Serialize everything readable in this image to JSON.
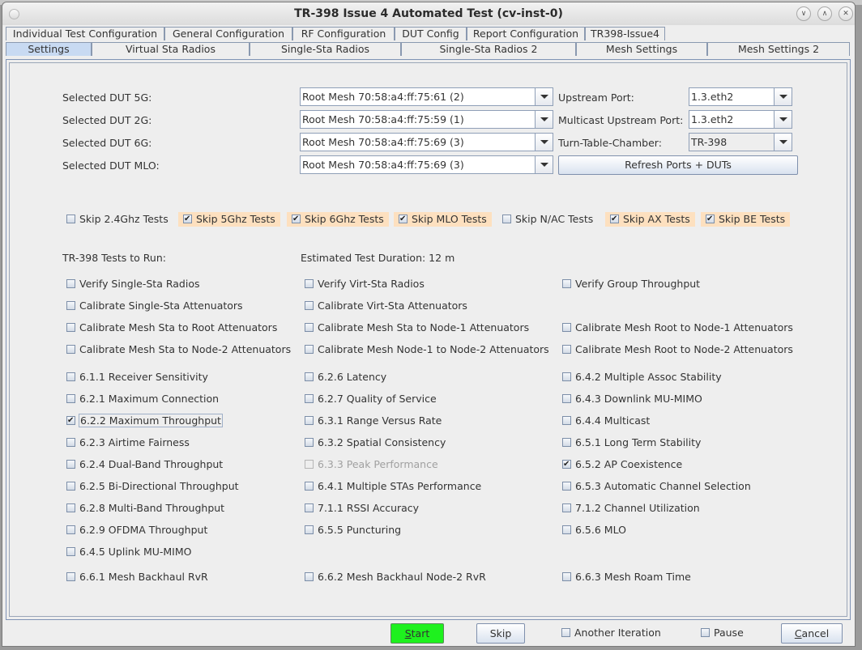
{
  "window": {
    "title": "TR-398 Issue 4 Automated Test  (cv-inst-0)",
    "controls": [
      "minimize",
      "maximize",
      "close"
    ]
  },
  "tabs_row1": [
    {
      "label": "Individual Test Configuration"
    },
    {
      "label": "General Configuration"
    },
    {
      "label": "RF Configuration"
    },
    {
      "label": "DUT Config"
    },
    {
      "label": "Report Configuration"
    },
    {
      "label": "TR398-Issue4"
    }
  ],
  "tabs_row2": [
    {
      "label": "Settings",
      "selected": true
    },
    {
      "label": "Virtual Sta Radios"
    },
    {
      "label": "Single-Sta Radios"
    },
    {
      "label": "Single-Sta Radios 2"
    },
    {
      "label": "Mesh Settings"
    },
    {
      "label": "Mesh Settings 2"
    }
  ],
  "settings": {
    "dut_fields": [
      {
        "label": "Selected DUT 5G:",
        "value": "Root Mesh 70:58:a4:ff:75:61 (2)"
      },
      {
        "label": "Selected DUT 2G:",
        "value": "Root Mesh 70:58:a4:ff:75:59 (1)"
      },
      {
        "label": "Selected DUT 6G:",
        "value": "Root Mesh 70:58:a4:ff:75:69 (3)"
      },
      {
        "label": "Selected DUT MLO:",
        "value": "Root Mesh 70:58:a4:ff:75:69 (3)"
      }
    ],
    "port_fields": [
      {
        "label": "Upstream Port:",
        "value": "1.3.eth2"
      },
      {
        "label": "Multicast Upstream Port:",
        "value": "1.3.eth2"
      },
      {
        "label": "Turn-Table-Chamber:",
        "value": "TR-398"
      }
    ],
    "refresh_button": "Refresh Ports + DUTs",
    "skip_options": [
      {
        "label": "Skip 2.4Ghz Tests",
        "checked": false
      },
      {
        "label": "Skip 5Ghz Tests",
        "checked": true
      },
      {
        "label": "Skip 6Ghz Tests",
        "checked": true
      },
      {
        "label": "Skip MLO Tests",
        "checked": true
      },
      {
        "label": "Skip N/AC Tests",
        "checked": false
      },
      {
        "label": "Skip AX Tests",
        "checked": true
      },
      {
        "label": "Skip BE Tests",
        "checked": true
      }
    ],
    "skip_highlight_color": "#fde0bf",
    "tests_to_run_label": "TR-398 Tests to Run:",
    "estimated_duration": "Estimated Test Duration: 12 m",
    "calibration": {
      "col1": [
        {
          "label": "Verify Single-Sta Radios",
          "checked": false
        },
        {
          "label": "Calibrate Single-Sta Attenuators",
          "checked": false
        },
        {
          "label": "Calibrate Mesh Sta to Root Attenuators",
          "checked": false
        },
        {
          "label": "Calibrate Mesh Sta to Node-2 Attenuators",
          "checked": false
        }
      ],
      "col2": [
        {
          "label": "Verify Virt-Sta Radios",
          "checked": false
        },
        {
          "label": "Calibrate Virt-Sta Attenuators",
          "checked": false
        },
        {
          "label": "Calibrate Mesh Sta to Node-1 Attenuators",
          "checked": false
        },
        {
          "label": "Calibrate Mesh Node-1 to Node-2 Attenuators",
          "checked": false
        }
      ],
      "col3": [
        {
          "label": "Verify Group Throughput",
          "checked": false
        },
        {
          "label": "Calibrate Mesh Root to Node-1 Attenuators",
          "checked": false
        },
        {
          "label": "Calibrate Mesh Root to Node-2 Attenuators",
          "checked": false
        }
      ]
    },
    "tests": {
      "col1": [
        {
          "label": "6.1.1 Receiver Sensitivity",
          "checked": false
        },
        {
          "label": "6.2.1 Maximum Connection",
          "checked": false
        },
        {
          "label": "6.2.2 Maximum Throughput",
          "checked": true,
          "focused": true
        },
        {
          "label": "6.2.3 Airtime Fairness",
          "checked": false
        },
        {
          "label": "6.2.4 Dual-Band Throughput",
          "checked": false
        },
        {
          "label": "6.2.5 Bi-Directional Throughput",
          "checked": false
        },
        {
          "label": "6.2.8 Multi-Band Throughput",
          "checked": false
        },
        {
          "label": "6.2.9 OFDMA Throughput",
          "checked": false
        },
        {
          "label": "6.4.5 Uplink MU-MIMO",
          "checked": false
        }
      ],
      "col2": [
        {
          "label": "6.2.6 Latency",
          "checked": false
        },
        {
          "label": "6.2.7 Quality of Service",
          "checked": false
        },
        {
          "label": "6.3.1 Range Versus Rate",
          "checked": false
        },
        {
          "label": "6.3.2 Spatial Consistency",
          "checked": false
        },
        {
          "label": "6.3.3 Peak Performance",
          "checked": false,
          "disabled": true
        },
        {
          "label": "6.4.1 Multiple STAs Performance",
          "checked": false
        },
        {
          "label": "7.1.1 RSSI Accuracy",
          "checked": false
        },
        {
          "label": "6.5.5 Puncturing",
          "checked": false
        }
      ],
      "col3": [
        {
          "label": "6.4.2 Multiple Assoc Stability",
          "checked": false
        },
        {
          "label": "6.4.3 Downlink MU-MIMO",
          "checked": false
        },
        {
          "label": "6.4.4 Multicast",
          "checked": false
        },
        {
          "label": "6.5.1 Long Term Stability",
          "checked": false
        },
        {
          "label": "6.5.2 AP Coexistence",
          "checked": true
        },
        {
          "label": "6.5.3 Automatic Channel Selection",
          "checked": false
        },
        {
          "label": "7.1.2 Channel Utilization",
          "checked": false
        },
        {
          "label": "6.5.6 MLO",
          "checked": false
        }
      ]
    },
    "mesh_tests": [
      {
        "label": "6.6.1 Mesh Backhaul RvR",
        "checked": false
      },
      {
        "label": "6.6.2 Mesh Backhaul Node-2 RvR",
        "checked": false
      },
      {
        "label": "6.6.3 Mesh Roam Time",
        "checked": false
      }
    ]
  },
  "footer": {
    "start": {
      "mnemonic": "S",
      "rest": "tart"
    },
    "start_color": "#1ef11e",
    "skip": "Skip",
    "another_iteration": {
      "label": "Another Iteration",
      "checked": false
    },
    "pause": {
      "label": "Pause",
      "checked": false
    },
    "cancel": {
      "mnemonic": "C",
      "rest": "ancel"
    }
  }
}
